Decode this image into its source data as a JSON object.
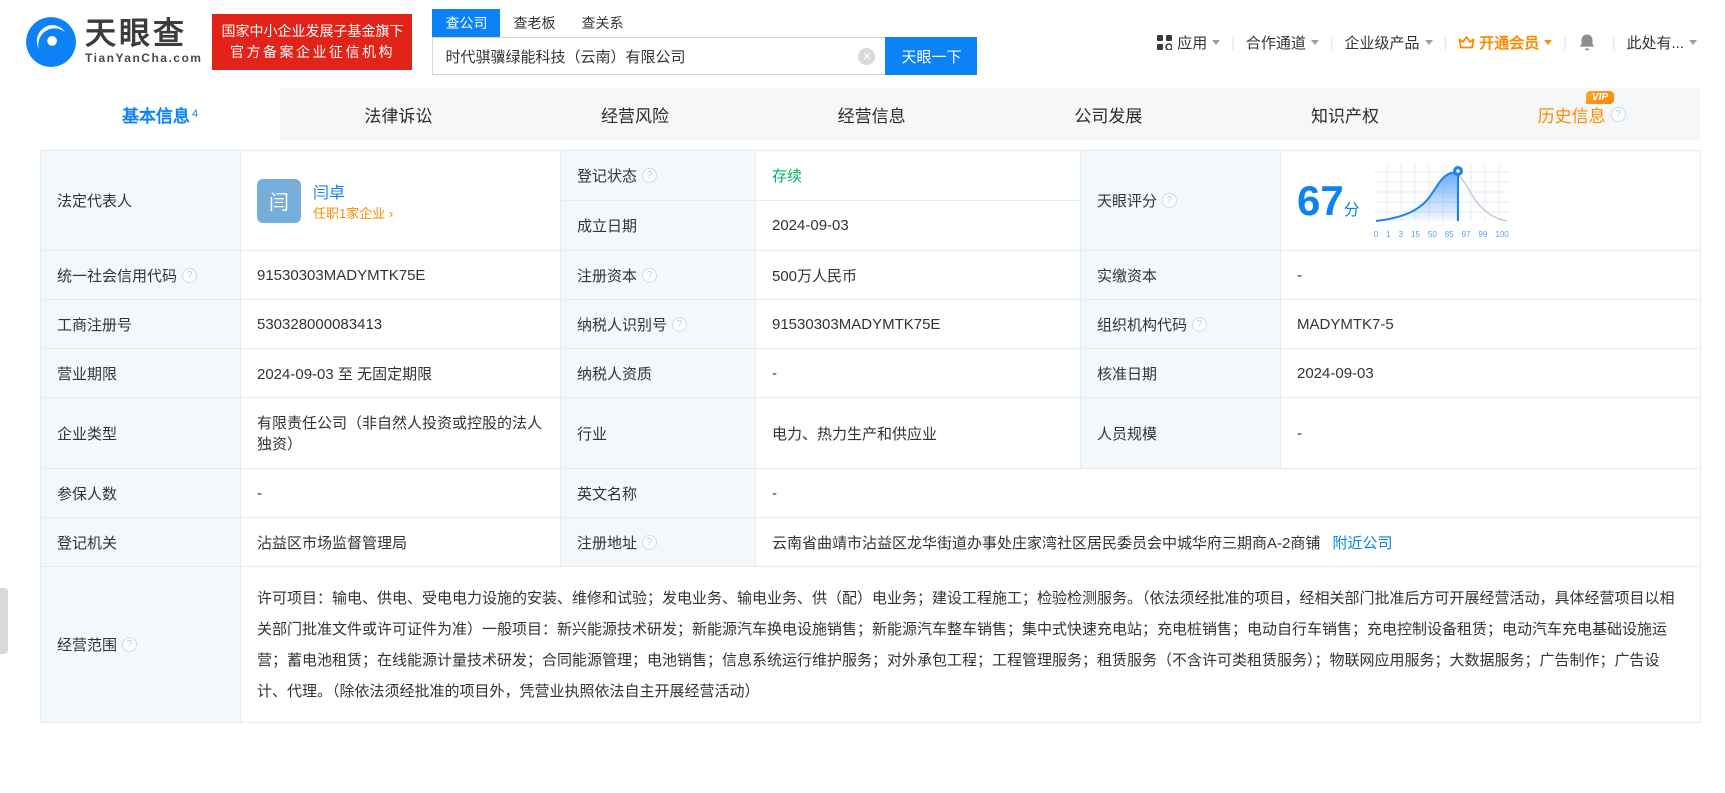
{
  "colors": {
    "accent_blue": "#0b82f5",
    "brand_red": "#e2231a",
    "vip_orange": "#ff8a00",
    "status_green": "#00b365"
  },
  "header": {
    "logo": {
      "brand": "天眼查",
      "domain": "TianYanCha.com"
    },
    "badge": {
      "line1": "国家中小企业发展子基金旗下",
      "line2": "官方备案企业征信机构"
    },
    "search": {
      "tabs": [
        {
          "label": "查公司"
        },
        {
          "label": "查老板"
        },
        {
          "label": "查关系"
        }
      ],
      "input_value": "时代骐骥绿能科技（云南）有限公司",
      "button": "天眼一下"
    },
    "nav": {
      "apps": "应用",
      "partner": "合作通道",
      "enterprise": "企业级产品",
      "vip": "开通会员",
      "user": "此处有..."
    }
  },
  "tabs_bar": {
    "items": [
      {
        "label": "基本信息",
        "count": "4"
      },
      {
        "label": "法律诉讼"
      },
      {
        "label": "经营风险"
      },
      {
        "label": "经营信息"
      },
      {
        "label": "公司发展"
      },
      {
        "label": "知识产权"
      },
      {
        "label": "历史信息",
        "vip": "VIP"
      }
    ]
  },
  "fields": {
    "legal_rep": {
      "label": "法定代表人",
      "avatar": "闫",
      "name": "闫卓",
      "sub_link": "任职1家企业 ›"
    },
    "reg_status": {
      "label": "登记状态",
      "value": "存续"
    },
    "est_date": {
      "label": "成立日期",
      "value": "2024-09-03"
    },
    "score": {
      "label": "天眼评分",
      "value": "67",
      "unit": "分"
    },
    "credit_code": {
      "label": "统一社会信用代码",
      "value": "91530303MADYMTK75E"
    },
    "reg_capital": {
      "label": "注册资本",
      "value": "500万人民币"
    },
    "paid_capital": {
      "label": "实缴资本",
      "value": "-"
    },
    "reg_number": {
      "label": "工商注册号",
      "value": "530328000083413"
    },
    "taxpayer_id": {
      "label": "纳税人识别号",
      "value": "91530303MADYMTK75E"
    },
    "org_code": {
      "label": "组织机构代码",
      "value": "MADYMTK7-5"
    },
    "business_term": {
      "label": "营业期限",
      "value": "2024-09-03 至 无固定期限"
    },
    "taxpayer_quality": {
      "label": "纳税人资质",
      "value": "-"
    },
    "approval_date": {
      "label": "核准日期",
      "value": "2024-09-03"
    },
    "company_type": {
      "label": "企业类型",
      "value": "有限责任公司（非自然人投资或控股的法人独资）"
    },
    "industry": {
      "label": "行业",
      "value": "电力、热力生产和供应业"
    },
    "staff_size": {
      "label": "人员规模",
      "value": "-"
    },
    "insured_count": {
      "label": "参保人数",
      "value": "-"
    },
    "english_name": {
      "label": "英文名称",
      "value": "-"
    },
    "reg_authority": {
      "label": "登记机关",
      "value": "沾益区市场监督管理局"
    },
    "reg_address": {
      "label": "注册地址",
      "value": "云南省曲靖市沾益区龙华街道办事处庄家湾社区居民委员会中城华府三期商A-2商铺",
      "link": "附近公司"
    },
    "business_scope": {
      "label": "经营范围",
      "value": "许可项目：输电、供电、受电电力设施的安装、维修和试验；发电业务、输电业务、供（配）电业务；建设工程施工；检验检测服务。（依法须经批准的项目，经相关部门批准后方可开展经营活动，具体经营项目以相关部门批准文件或许可证件为准）一般项目：新兴能源技术研发；新能源汽车换电设施销售；新能源汽车整车销售；集中式快速充电站；充电桩销售；电动自行车销售；充电控制设备租赁；电动汽车充电基础设施运营；蓄电池租赁；在线能源计量技术研发；合同能源管理；电池销售；信息系统运行维护服务；对外承包工程；工程管理服务；租赁服务（不含许可类租赁服务）；物联网应用服务；大数据服务；广告制作；广告设计、代理。（除依法须经批准的项目外，凭营业执照依法自主开展经营活动）"
    }
  },
  "chart_data": {
    "type": "area",
    "title": "天眼评分分布曲线",
    "x_tick_labels": [
      "0",
      "1",
      "3",
      "15",
      "50",
      "85",
      "97",
      "99",
      "100"
    ],
    "marker_score": 67,
    "grid": true,
    "note": "钟形分布曲线，蓝色填充至评分标记处，其后为灰色曲线"
  }
}
